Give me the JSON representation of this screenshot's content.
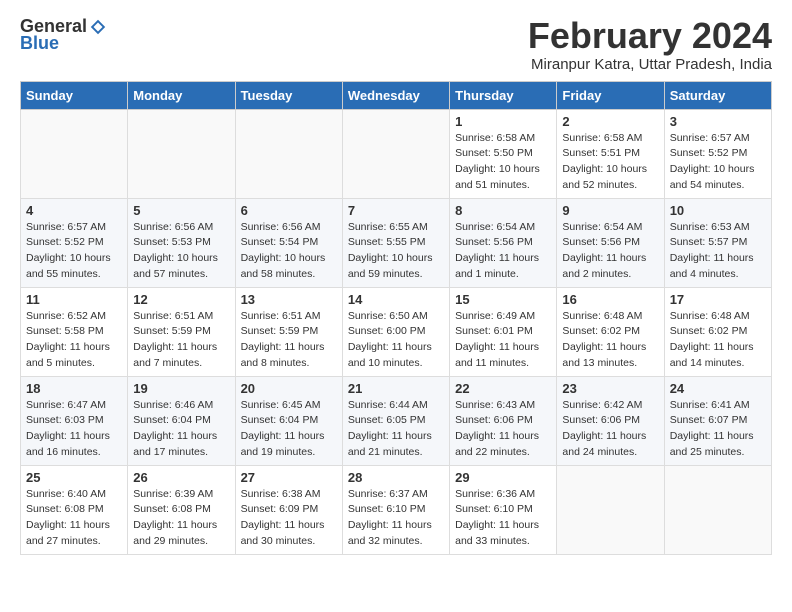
{
  "logo": {
    "general": "General",
    "blue": "Blue"
  },
  "title": "February 2024",
  "subtitle": "Miranpur Katra, Uttar Pradesh, India",
  "days_header": [
    "Sunday",
    "Monday",
    "Tuesday",
    "Wednesday",
    "Thursday",
    "Friday",
    "Saturday"
  ],
  "weeks": [
    [
      {
        "day": "",
        "info": ""
      },
      {
        "day": "",
        "info": ""
      },
      {
        "day": "",
        "info": ""
      },
      {
        "day": "",
        "info": ""
      },
      {
        "day": "1",
        "info": "Sunrise: 6:58 AM\nSunset: 5:50 PM\nDaylight: 10 hours\nand 51 minutes."
      },
      {
        "day": "2",
        "info": "Sunrise: 6:58 AM\nSunset: 5:51 PM\nDaylight: 10 hours\nand 52 minutes."
      },
      {
        "day": "3",
        "info": "Sunrise: 6:57 AM\nSunset: 5:52 PM\nDaylight: 10 hours\nand 54 minutes."
      }
    ],
    [
      {
        "day": "4",
        "info": "Sunrise: 6:57 AM\nSunset: 5:52 PM\nDaylight: 10 hours\nand 55 minutes."
      },
      {
        "day": "5",
        "info": "Sunrise: 6:56 AM\nSunset: 5:53 PM\nDaylight: 10 hours\nand 57 minutes."
      },
      {
        "day": "6",
        "info": "Sunrise: 6:56 AM\nSunset: 5:54 PM\nDaylight: 10 hours\nand 58 minutes."
      },
      {
        "day": "7",
        "info": "Sunrise: 6:55 AM\nSunset: 5:55 PM\nDaylight: 10 hours\nand 59 minutes."
      },
      {
        "day": "8",
        "info": "Sunrise: 6:54 AM\nSunset: 5:56 PM\nDaylight: 11 hours\nand 1 minute."
      },
      {
        "day": "9",
        "info": "Sunrise: 6:54 AM\nSunset: 5:56 PM\nDaylight: 11 hours\nand 2 minutes."
      },
      {
        "day": "10",
        "info": "Sunrise: 6:53 AM\nSunset: 5:57 PM\nDaylight: 11 hours\nand 4 minutes."
      }
    ],
    [
      {
        "day": "11",
        "info": "Sunrise: 6:52 AM\nSunset: 5:58 PM\nDaylight: 11 hours\nand 5 minutes."
      },
      {
        "day": "12",
        "info": "Sunrise: 6:51 AM\nSunset: 5:59 PM\nDaylight: 11 hours\nand 7 minutes."
      },
      {
        "day": "13",
        "info": "Sunrise: 6:51 AM\nSunset: 5:59 PM\nDaylight: 11 hours\nand 8 minutes."
      },
      {
        "day": "14",
        "info": "Sunrise: 6:50 AM\nSunset: 6:00 PM\nDaylight: 11 hours\nand 10 minutes."
      },
      {
        "day": "15",
        "info": "Sunrise: 6:49 AM\nSunset: 6:01 PM\nDaylight: 11 hours\nand 11 minutes."
      },
      {
        "day": "16",
        "info": "Sunrise: 6:48 AM\nSunset: 6:02 PM\nDaylight: 11 hours\nand 13 minutes."
      },
      {
        "day": "17",
        "info": "Sunrise: 6:48 AM\nSunset: 6:02 PM\nDaylight: 11 hours\nand 14 minutes."
      }
    ],
    [
      {
        "day": "18",
        "info": "Sunrise: 6:47 AM\nSunset: 6:03 PM\nDaylight: 11 hours\nand 16 minutes."
      },
      {
        "day": "19",
        "info": "Sunrise: 6:46 AM\nSunset: 6:04 PM\nDaylight: 11 hours\nand 17 minutes."
      },
      {
        "day": "20",
        "info": "Sunrise: 6:45 AM\nSunset: 6:04 PM\nDaylight: 11 hours\nand 19 minutes."
      },
      {
        "day": "21",
        "info": "Sunrise: 6:44 AM\nSunset: 6:05 PM\nDaylight: 11 hours\nand 21 minutes."
      },
      {
        "day": "22",
        "info": "Sunrise: 6:43 AM\nSunset: 6:06 PM\nDaylight: 11 hours\nand 22 minutes."
      },
      {
        "day": "23",
        "info": "Sunrise: 6:42 AM\nSunset: 6:06 PM\nDaylight: 11 hours\nand 24 minutes."
      },
      {
        "day": "24",
        "info": "Sunrise: 6:41 AM\nSunset: 6:07 PM\nDaylight: 11 hours\nand 25 minutes."
      }
    ],
    [
      {
        "day": "25",
        "info": "Sunrise: 6:40 AM\nSunset: 6:08 PM\nDaylight: 11 hours\nand 27 minutes."
      },
      {
        "day": "26",
        "info": "Sunrise: 6:39 AM\nSunset: 6:08 PM\nDaylight: 11 hours\nand 29 minutes."
      },
      {
        "day": "27",
        "info": "Sunrise: 6:38 AM\nSunset: 6:09 PM\nDaylight: 11 hours\nand 30 minutes."
      },
      {
        "day": "28",
        "info": "Sunrise: 6:37 AM\nSunset: 6:10 PM\nDaylight: 11 hours\nand 32 minutes."
      },
      {
        "day": "29",
        "info": "Sunrise: 6:36 AM\nSunset: 6:10 PM\nDaylight: 11 hours\nand 33 minutes."
      },
      {
        "day": "",
        "info": ""
      },
      {
        "day": "",
        "info": ""
      }
    ]
  ]
}
